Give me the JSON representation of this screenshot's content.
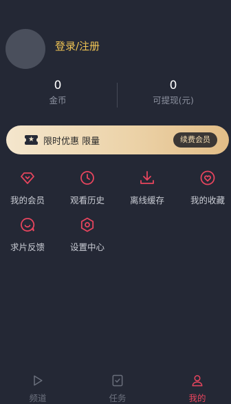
{
  "profile": {
    "login_label": "登录/注册"
  },
  "stats": [
    {
      "value": "0",
      "label": "金币"
    },
    {
      "value": "0",
      "label": "可提现(元)"
    }
  ],
  "banner": {
    "text": "限时优惠 限量",
    "button": "续费会员",
    "icon": "vip-ticket-icon"
  },
  "menu": [
    {
      "label": "我的会员",
      "icon": "diamond-icon"
    },
    {
      "label": "观看历史",
      "icon": "clock-icon"
    },
    {
      "label": "离线缓存",
      "icon": "download-icon"
    },
    {
      "label": "我的收藏",
      "icon": "heart-icon"
    },
    {
      "label": "求片反馈",
      "icon": "feedback-icon"
    },
    {
      "label": "设置中心",
      "icon": "settings-icon"
    }
  ],
  "tabbar": [
    {
      "label": "频道",
      "icon": "play-icon",
      "active": false
    },
    {
      "label": "任务",
      "icon": "task-icon",
      "active": false
    },
    {
      "label": "我的",
      "icon": "user-icon",
      "active": true
    }
  ],
  "colors": {
    "accent": "#e8455e",
    "gold": "#f0c454",
    "background": "#242835"
  }
}
